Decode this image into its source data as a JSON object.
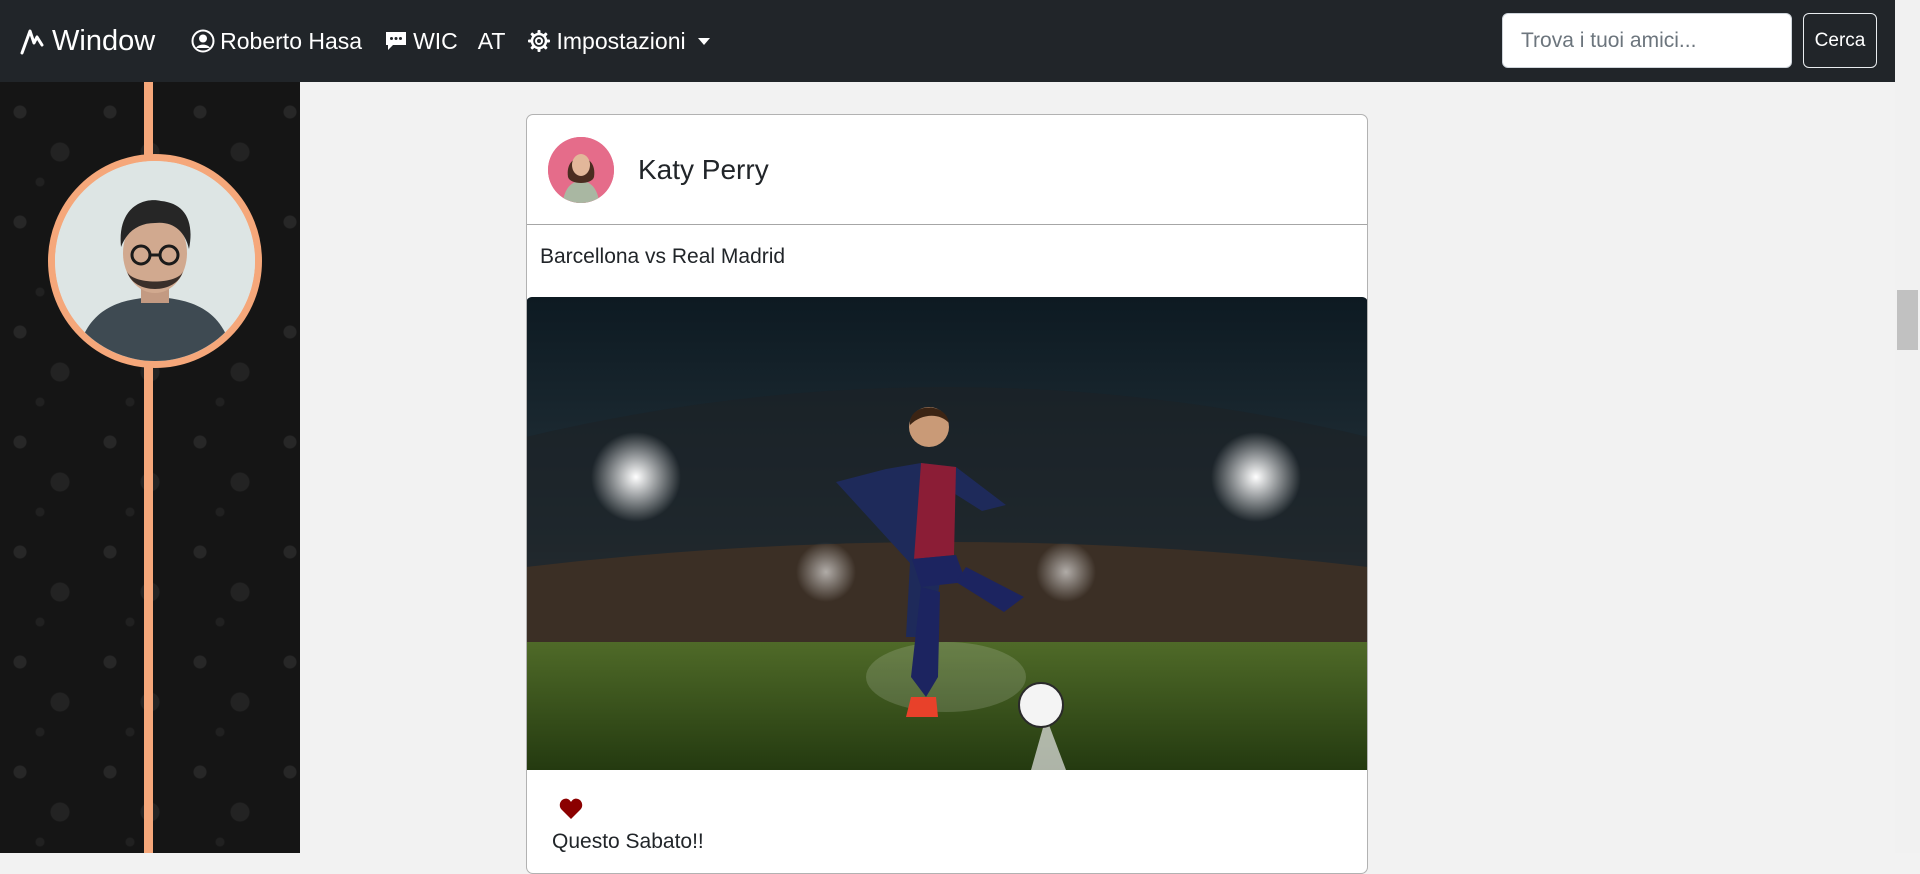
{
  "navbar": {
    "brand": "Window",
    "brand_icon": "activity-icon",
    "profile_label": "Roberto Hasa",
    "chat_label": "WIC",
    "at_label": "AT",
    "settings_label": "Impostazioni",
    "search_placeholder": "Trova i tuoi amici...",
    "search_button": "Cerca"
  },
  "sidebar": {
    "accent_color": "#f5a77a"
  },
  "post": {
    "author": "Katy Perry",
    "title": "Barcellona vs Real Madrid",
    "caption": "Questo Sabato!!",
    "liked": true,
    "like_color": "#8b0000"
  }
}
